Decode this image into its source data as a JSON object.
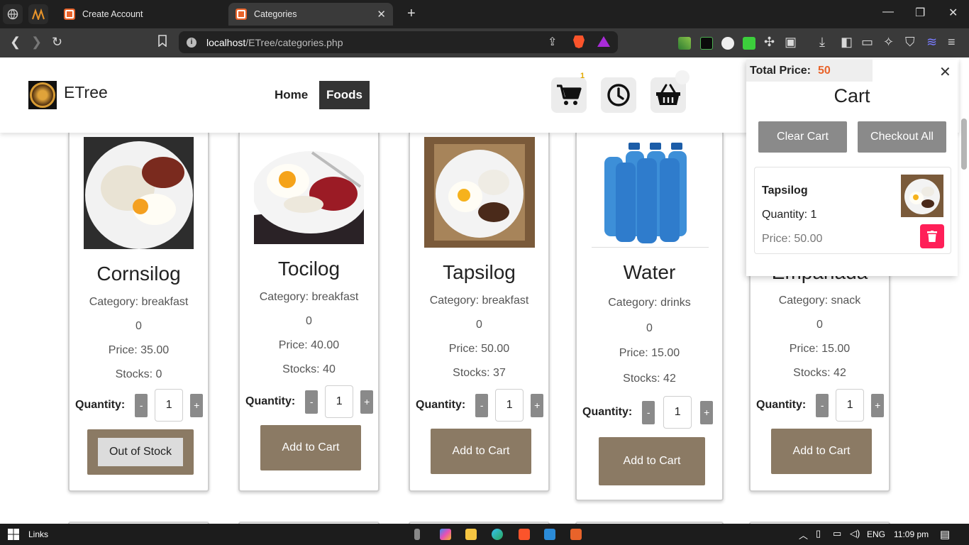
{
  "browser": {
    "tabs": [
      {
        "title": "Create Account",
        "active": false
      },
      {
        "title": "Categories",
        "active": true
      }
    ],
    "url_host": "localhost",
    "url_path": "/ETree/categories.php"
  },
  "header": {
    "brand": "ETree",
    "nav": [
      {
        "label": "Home",
        "active": false
      },
      {
        "label": "Foods",
        "active": true
      }
    ],
    "cart_count": "1"
  },
  "products": [
    {
      "name": "Cornsilog",
      "category": "Category: breakfast",
      "count": "0",
      "price": "Price: 35.00",
      "stocks": "Stocks: 0",
      "quantity_label": "Quantity:",
      "minus": "-",
      "qty": "1",
      "plus": "+",
      "button": "Out of Stock",
      "out_of_stock": true
    },
    {
      "name": "Tocilog",
      "category": "Category: breakfast",
      "count": "0",
      "price": "Price: 40.00",
      "stocks": "Stocks: 40",
      "quantity_label": "Quantity:",
      "minus": "-",
      "qty": "1",
      "plus": "+",
      "button": "Add to Cart",
      "out_of_stock": false
    },
    {
      "name": "Tapsilog",
      "category": "Category: breakfast",
      "count": "0",
      "price": "Price: 50.00",
      "stocks": "Stocks: 37",
      "quantity_label": "Quantity:",
      "minus": "-",
      "qty": "1",
      "plus": "+",
      "button": "Add to Cart",
      "out_of_stock": false
    },
    {
      "name": "Water",
      "category": "Category: drinks",
      "count": "0",
      "price": "Price: 15.00",
      "stocks": "Stocks: 42",
      "quantity_label": "Quantity:",
      "minus": "-",
      "qty": "1",
      "plus": "+",
      "button": "Add to Cart",
      "out_of_stock": false
    },
    {
      "name": "Empanada",
      "category": "Category: snack",
      "count": "0",
      "price": "Price: 15.00",
      "stocks": "Stocks: 42",
      "quantity_label": "Quantity:",
      "minus": "-",
      "qty": "1",
      "plus": "+",
      "button": "Add to Cart",
      "out_of_stock": false
    }
  ],
  "cart": {
    "total_label": "Total Price:",
    "total_value": "50",
    "title": "Cart",
    "clear_label": "Clear Cart",
    "checkout_label": "Checkout All",
    "items": [
      {
        "name": "Tapsilog",
        "quantity": "Quantity: 1",
        "price": "Price: 50.00"
      }
    ]
  },
  "taskbar": {
    "links_label": "Links",
    "language": "ENG",
    "time": "11:09 pm"
  },
  "colors": {
    "accent_button": "#8b7a64",
    "total_price": "#e8632a",
    "delete": "#ff1f58",
    "nav_active": "#333333"
  }
}
